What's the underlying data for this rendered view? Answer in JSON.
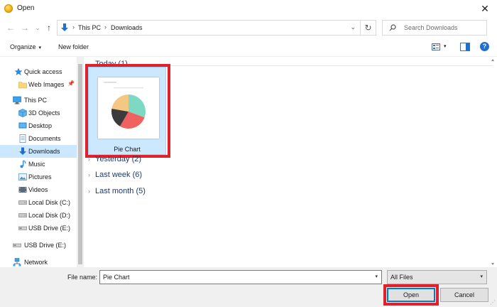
{
  "window": {
    "title": "Open",
    "close_glyph": "✕"
  },
  "nav": {
    "back_glyph": "←",
    "forward_glyph": "→",
    "recent_glyph": "⌄",
    "up_glyph": "↑",
    "breadcrumbs": [
      "This PC",
      "Downloads"
    ],
    "breadcrumb_sep": "›",
    "refresh_glyph": "↻",
    "dropdown_glyph": "⌄",
    "search_placeholder": "Search Downloads"
  },
  "toolbar": {
    "organize": "Organize",
    "organize_caret": "▾",
    "new_folder": "New folder",
    "view_caret": "▾",
    "help_glyph": "?"
  },
  "sidebar": {
    "items": [
      {
        "label": "Quick access",
        "icon": "star-icon"
      },
      {
        "label": "Web Images",
        "icon": "folder-icon",
        "pin": "📌"
      },
      {
        "label": "This PC",
        "icon": "computer-icon"
      },
      {
        "label": "3D Objects",
        "icon": "cube-icon"
      },
      {
        "label": "Desktop",
        "icon": "desktop-icon"
      },
      {
        "label": "Documents",
        "icon": "documents-icon"
      },
      {
        "label": "Downloads",
        "icon": "download-icon",
        "selected": true
      },
      {
        "label": "Music",
        "icon": "music-icon"
      },
      {
        "label": "Pictures",
        "icon": "pictures-icon"
      },
      {
        "label": "Videos",
        "icon": "videos-icon"
      },
      {
        "label": "Local Disk (C:)",
        "icon": "drive-icon"
      },
      {
        "label": "Local Disk (D:)",
        "icon": "drive-icon"
      },
      {
        "label": "USB Drive (E:)",
        "icon": "usb-drive-icon"
      },
      {
        "label": "USB Drive (E:)",
        "icon": "usb-drive-icon"
      },
      {
        "label": "Network",
        "icon": "network-icon"
      }
    ]
  },
  "groups": [
    {
      "label": "Today (1)",
      "expanded": true
    },
    {
      "label": "Yesterday (2)",
      "expanded": false
    },
    {
      "label": "Last week (6)",
      "expanded": false
    },
    {
      "label": "Last month (5)",
      "expanded": false
    }
  ],
  "group_glyphs": {
    "expanded": "⌄",
    "collapsed": "›"
  },
  "file": {
    "name": "Pie Chart",
    "selected": true
  },
  "pie_colors": [
    "#7ed9c2",
    "#f0625f",
    "#3b3b3b",
    "#f2c883"
  ],
  "filebar": {
    "label": "File name:",
    "value": "Pie Chart",
    "filter": "All Files",
    "caret": "▾",
    "open": "Open",
    "cancel": "Cancel",
    "grip": "⋰"
  },
  "colors": {
    "selection": "#cce8ff",
    "highlight_border": "#e0202a",
    "accent": "#0078d7"
  }
}
